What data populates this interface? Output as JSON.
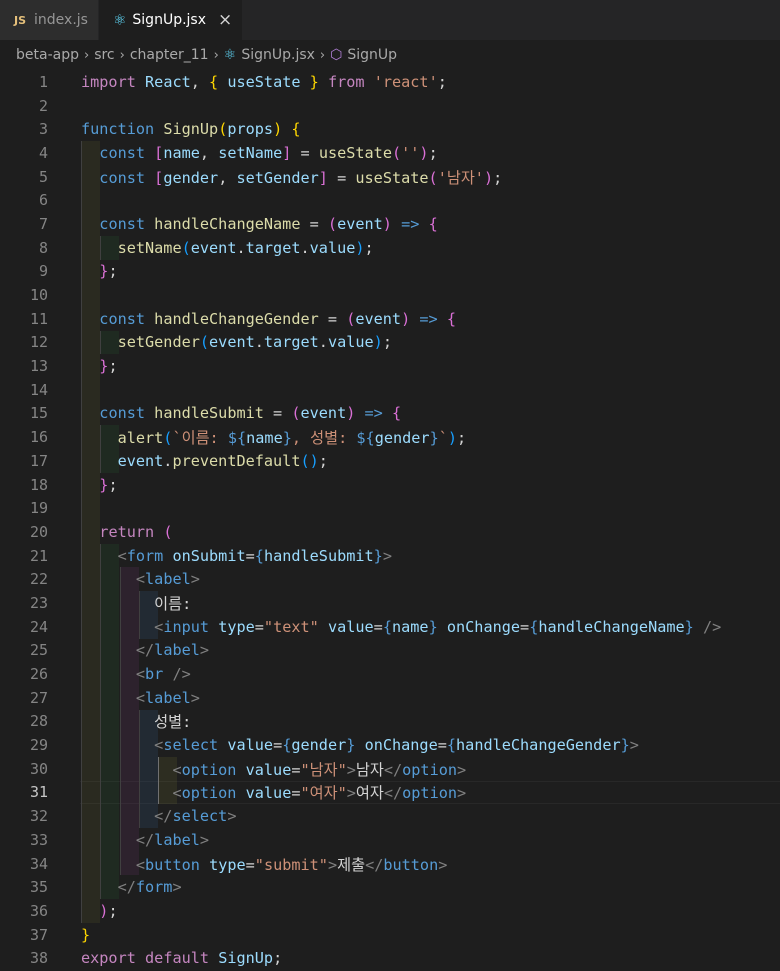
{
  "tabs": [
    {
      "icon": "js-file-icon",
      "icon_text": "JS",
      "label": "index.js",
      "active": false
    },
    {
      "icon": "react-file-icon",
      "label": "SignUp.jsx",
      "active": true,
      "close": "×"
    }
  ],
  "breadcrumb": {
    "items": [
      "beta-app",
      "src",
      "chapter_11",
      "SignUp.jsx",
      "SignUp"
    ],
    "separator": "›"
  },
  "editor": {
    "current_line": 31,
    "line_numbers": [
      "1",
      "2",
      "3",
      "4",
      "5",
      "6",
      "7",
      "8",
      "9",
      "10",
      "11",
      "12",
      "13",
      "14",
      "15",
      "16",
      "17",
      "18",
      "19",
      "20",
      "21",
      "22",
      "23",
      "24",
      "25",
      "26",
      "27",
      "28",
      "29",
      "30",
      "31",
      "32",
      "33",
      "34",
      "35",
      "36",
      "37",
      "38"
    ],
    "t": {
      "import": "import",
      "react_name": "React",
      "usestate": "useState",
      "from": "from",
      "react_str": "'react'",
      "function": "function",
      "signup": "SignUp",
      "props": "props",
      "const": "const",
      "name": "name",
      "setname": "setName",
      "gender": "gender",
      "setgender": "setGender",
      "empty_str": "''",
      "male_str": "'남자'",
      "handle_name": "handleChangeName",
      "handle_gender": "handleChangeGender",
      "handle_submit": "handleSubmit",
      "event": "event",
      "target": "target",
      "value": "value",
      "alert": "alert",
      "tpl_a": "`이름: ",
      "tpl_b": ", 성별: ",
      "tpl_c": "`",
      "prevent": "preventDefault",
      "return": "return",
      "form": "form",
      "onsubmit": "onSubmit",
      "label": "label",
      "name_text": "이름:",
      "input": "input",
      "type": "type",
      "text_str": "\"text\"",
      "onchange": "onChange",
      "br": "br",
      "gender_text": "성별:",
      "select": "select",
      "option": "option",
      "male_q": "\"남자\"",
      "male": "남자",
      "female_q": "\"여자\"",
      "female": "여자",
      "button": "button",
      "submit_str": "\"submit\"",
      "submit_text": "제출",
      "export": "export",
      "default": "default"
    }
  }
}
